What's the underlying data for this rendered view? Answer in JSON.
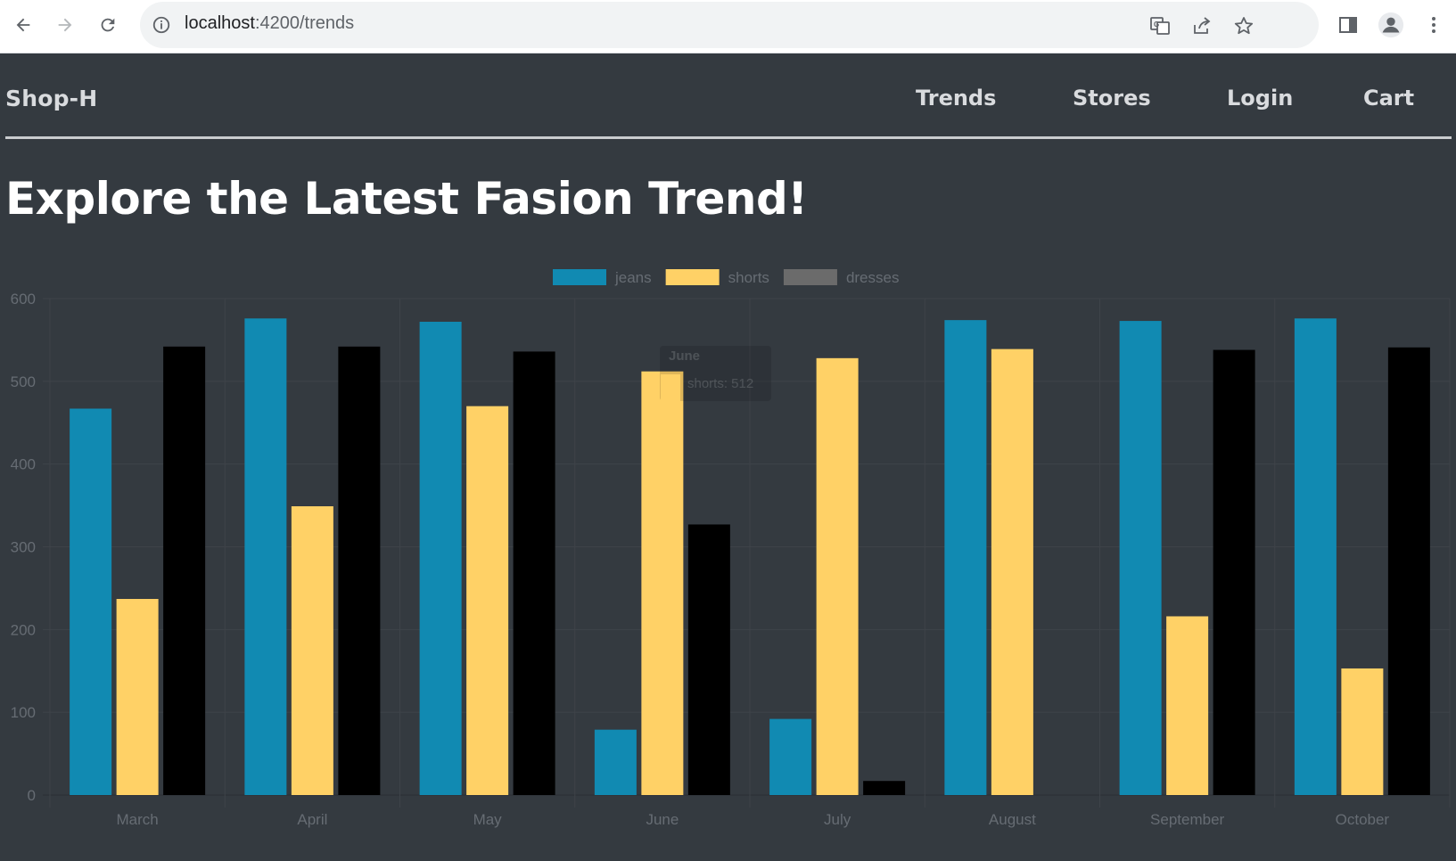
{
  "browser": {
    "url_host": "localhost",
    "url_path": ":4200/trends",
    "icons": [
      "back-arrow-icon",
      "forward-arrow-icon",
      "reload-icon",
      "info-icon",
      "translate-icon",
      "share-icon",
      "star-icon",
      "side-panel-icon",
      "profile-icon",
      "menu-dots-icon"
    ]
  },
  "nav": {
    "brand": "Shop-H",
    "links": [
      "Trends",
      "Stores",
      "Login",
      "Cart"
    ]
  },
  "page": {
    "title": "Explore the Latest Fasion Trend!"
  },
  "tooltip": {
    "title": "June",
    "line": "shorts: 512"
  },
  "chart_data": {
    "type": "bar",
    "categories": [
      "March",
      "April",
      "May",
      "June",
      "July",
      "August",
      "September",
      "October"
    ],
    "series": [
      {
        "name": "jeans",
        "color": "#118ab2",
        "values": [
          467,
          576,
          572,
          79,
          92,
          574,
          573,
          576
        ]
      },
      {
        "name": "shorts",
        "color": "#ffd166",
        "values": [
          237,
          349,
          470,
          512,
          528,
          539,
          216,
          153
        ]
      },
      {
        "name": "dresses",
        "color": "#000000",
        "values": [
          542,
          542,
          536,
          327,
          17,
          0,
          538,
          541
        ]
      }
    ],
    "legend_swatch_colors": [
      "#118ab2",
      "#ffd166",
      "#6b6b6b"
    ],
    "ylim": [
      0,
      600
    ],
    "yticks": [
      0,
      100,
      200,
      300,
      400,
      500,
      600
    ],
    "legend_position": "top",
    "grid": true
  }
}
